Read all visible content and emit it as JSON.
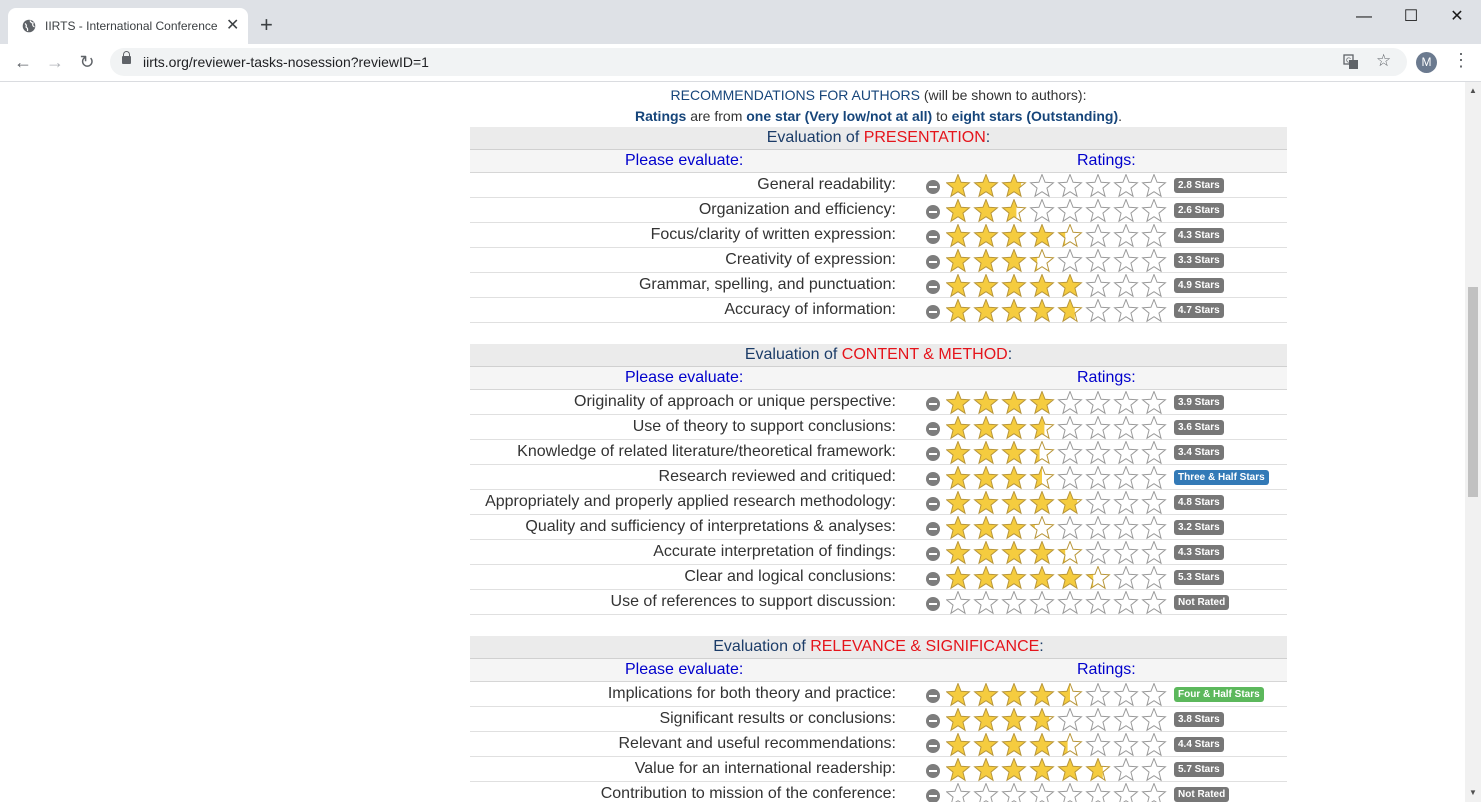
{
  "browser": {
    "tab_title": "IIRTS - International Conference o",
    "url": "iirts.org/reviewer-tasks-nosession?reviewID=1",
    "avatar_letter": "M",
    "new_tab": "+",
    "minimize": "—",
    "maximize": "☐",
    "close": "✕",
    "tab_close": "✕"
  },
  "intro": {
    "line1_strong": "RECOMMENDATIONS FOR AUTHORS",
    "line1_rest": " (will be shown to authors):",
    "line2_a": "Ratings",
    "line2_b": " are from ",
    "line2_c": "one star (Very low/not at all)",
    "line2_d": " to ",
    "line2_e": "eight stars (Outstanding)",
    "line2_f": "."
  },
  "labels": {
    "eval_prefix": "Evaluation of ",
    "please_evaluate": "Please evaluate:",
    "ratings": "Ratings:",
    "colon": ":"
  },
  "colors": {
    "star_fill": "#f5cc3f",
    "star_stroke": "#b8963a",
    "star_empty_stroke": "#9a9a9a",
    "heading_red": "#e5141b",
    "heading_blue": "#1b3c68",
    "column_blue": "#0000cc"
  },
  "max_stars": 8,
  "sections": [
    {
      "title": "PRESENTATION",
      "items": [
        {
          "label": "General readability:",
          "rating": 2.8,
          "badge": "2.8 Stars",
          "badge_style": "gray"
        },
        {
          "label": "Organization and efficiency:",
          "rating": 2.6,
          "badge": "2.6 Stars",
          "badge_style": "gray"
        },
        {
          "label": "Focus/clarity of written expression:",
          "rating": 4.3,
          "badge": "4.3 Stars",
          "badge_style": "gray"
        },
        {
          "label": "Creativity of expression:",
          "rating": 3.3,
          "badge": "3.3 Stars",
          "badge_style": "gray"
        },
        {
          "label": "Grammar, spelling, and punctuation:",
          "rating": 4.9,
          "badge": "4.9 Stars",
          "badge_style": "gray"
        },
        {
          "label": "Accuracy of information:",
          "rating": 4.7,
          "badge": "4.7 Stars",
          "badge_style": "gray"
        }
      ]
    },
    {
      "title": "CONTENT & METHOD",
      "items": [
        {
          "label": "Originality of approach or unique perspective:",
          "rating": 3.9,
          "badge": "3.9 Stars",
          "badge_style": "gray"
        },
        {
          "label": "Use of theory to support conclusions:",
          "rating": 3.6,
          "badge": "3.6 Stars",
          "badge_style": "gray"
        },
        {
          "label": "Knowledge of related literature/theoretical framework:",
          "rating": 3.4,
          "badge": "3.4 Stars",
          "badge_style": "gray"
        },
        {
          "label": "Research reviewed and critiqued:",
          "rating": 3.5,
          "badge": "Three & Half Stars",
          "badge_style": "blue"
        },
        {
          "label": "Appropriately and properly applied research methodology:",
          "rating": 4.8,
          "badge": "4.8 Stars",
          "badge_style": "gray"
        },
        {
          "label": "Quality and sufficiency of interpretations & analyses:",
          "rating": 3.2,
          "badge": "3.2 Stars",
          "badge_style": "gray"
        },
        {
          "label": "Accurate interpretation of findings:",
          "rating": 4.3,
          "badge": "4.3 Stars",
          "badge_style": "gray"
        },
        {
          "label": "Clear and logical conclusions:",
          "rating": 5.3,
          "badge": "5.3 Stars",
          "badge_style": "gray"
        },
        {
          "label": "Use of references to support discussion:",
          "rating": 0,
          "badge": "Not Rated",
          "badge_style": "gray"
        }
      ]
    },
    {
      "title": "RELEVANCE & SIGNIFICANCE",
      "items": [
        {
          "label": "Implications for both theory and practice:",
          "rating": 4.5,
          "badge": "Four & Half Stars",
          "badge_style": "green"
        },
        {
          "label": "Significant results or conclusions:",
          "rating": 3.8,
          "badge": "3.8 Stars",
          "badge_style": "gray"
        },
        {
          "label": "Relevant and useful recommendations:",
          "rating": 4.4,
          "badge": "4.4 Stars",
          "badge_style": "gray"
        },
        {
          "label": "Value for an international readership:",
          "rating": 5.7,
          "badge": "5.7 Stars",
          "badge_style": "gray"
        },
        {
          "label": "Contribution to mission of the conference:",
          "rating": 0,
          "badge": "Not Rated",
          "badge_style": "gray"
        }
      ]
    }
  ]
}
